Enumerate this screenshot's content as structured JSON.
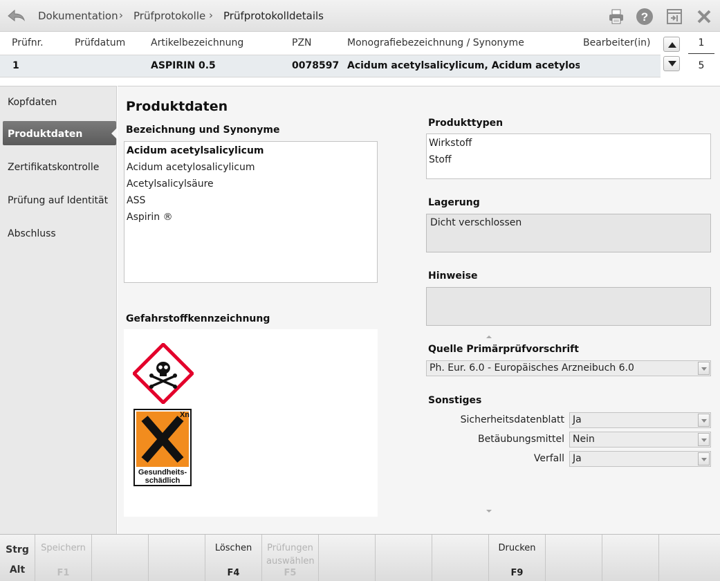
{
  "breadcrumb": [
    "Dokumentation",
    "Prüfprotokolle",
    "Prüfprotokolldetails"
  ],
  "icons": {
    "back": "back-arrow-icon",
    "print": "printer-icon",
    "help": "help-icon",
    "window": "window-icon",
    "close": "close-icon"
  },
  "header": {
    "columns": [
      "Prüfnr.",
      "Prüfdatum",
      "Artikelbezeichnung",
      "PZN",
      "Monografiebezeichnung / Synonyme",
      "Bearbeiter(in)"
    ],
    "row": {
      "nr": "1",
      "date": "",
      "article": "ASPIRIN 0.5",
      "pzn": "0078597",
      "monograph": "Acidum acetylsalicylicum, Acidum acetylosalicyli",
      "editor": ""
    },
    "pager": {
      "current": "1",
      "total": "5"
    }
  },
  "sidebar": {
    "items": [
      {
        "label": "Kopfdaten"
      },
      {
        "label": "Produktdaten",
        "active": true
      },
      {
        "label": "Zertifikatskontrolle"
      },
      {
        "label": "Prüfung auf Identität"
      },
      {
        "label": "Abschluss"
      }
    ]
  },
  "main": {
    "title": "Produktdaten",
    "synonyms_label": "Bezeichnung und Synonyme",
    "synonyms": [
      "Acidum acetylsalicylicum",
      "Acidum acetylosalicylicum",
      "Acetylsalicylsäure",
      "ASS",
      "Aspirin ®"
    ],
    "hazard_label": "Gefahrstoffkennzeichnung",
    "hazard_xn_code": "Xn",
    "hazard_xn_text1": "Gesundheits-",
    "hazard_xn_text2": "schädlich",
    "product_types_label": "Produkttypen",
    "product_types": [
      "Wirkstoff",
      "Stoff"
    ],
    "storage_label": "Lagerung",
    "storage_value": "Dicht verschlossen",
    "notes_label": "Hinweise",
    "notes_value": "",
    "source_label": "Quelle Primärprüfvorschrift",
    "source_value": "Ph. Eur. 6.0 - Europäisches Arzneibuch 6.0",
    "other_label": "Sonstiges",
    "other": [
      {
        "label": "Sicherheitsdatenblatt",
        "value": "Ja"
      },
      {
        "label": "Betäubungsmittel",
        "value": "Nein"
      },
      {
        "label": "Verfall",
        "value": "Ja"
      }
    ]
  },
  "fkeys": {
    "mod_top": "Strg",
    "mod_bottom": "Alt",
    "keys": [
      {
        "label": "Speichern",
        "key": "F1",
        "disabled": true
      },
      {
        "label": "",
        "key": ""
      },
      {
        "label": "",
        "key": ""
      },
      {
        "label": "Löschen",
        "key": "F4"
      },
      {
        "label": "Prüfungen auswählen",
        "key": "F5",
        "disabled": true
      },
      {
        "label": "",
        "key": ""
      },
      {
        "label": "",
        "key": ""
      },
      {
        "label": "",
        "key": ""
      },
      {
        "label": "Drucken",
        "key": "F9"
      },
      {
        "label": "",
        "key": ""
      },
      {
        "label": "",
        "key": ""
      },
      {
        "label": "",
        "key": ""
      }
    ]
  }
}
